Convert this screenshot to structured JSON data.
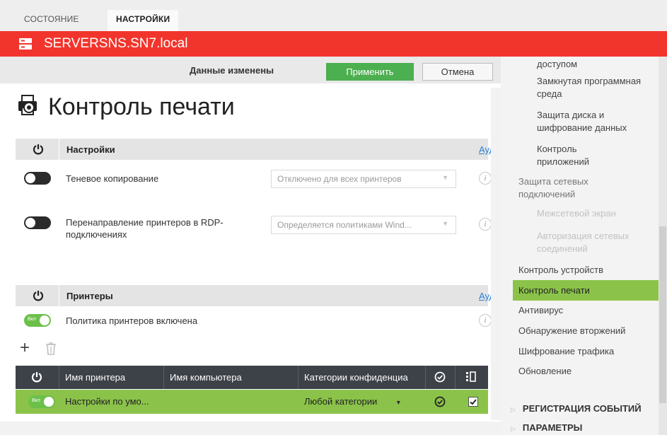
{
  "tabs": [
    {
      "label": "СОСТОЯНИЕ"
    },
    {
      "label": "НАСТРОЙКИ"
    }
  ],
  "server": {
    "name": "SERVERSNS.SN7.local"
  },
  "actionbar": {
    "status": "Данные изменены",
    "apply_label": "Применить",
    "cancel_label": "Отмена"
  },
  "page": {
    "title": "Контроль печати"
  },
  "settings_section": {
    "title": "Настройки",
    "audit_link": "Ауд",
    "options": [
      {
        "label": "Теневое копирование",
        "enabled": false,
        "select_value": "Отключено для всех принтеров"
      },
      {
        "label": "Перенаправление принтеров в RDP-подключениях",
        "enabled": false,
        "select_value": "Определяется политиками Wind..."
      }
    ]
  },
  "printers_section": {
    "title": "Принтеры",
    "audit_link": "Ауд",
    "policy_label": "Политика принтеров включена",
    "policy_toggle_text": "Вкл",
    "policy_enabled": true
  },
  "table": {
    "columns": [
      "Имя принтера",
      "Имя компьютера",
      "Категории конфиденциа"
    ],
    "rows": [
      {
        "toggle_text": "Вкл",
        "printer": "Настройки по умо...",
        "computer": "",
        "category": "Любой категории",
        "checked": true
      }
    ]
  },
  "sidebar": {
    "items": [
      {
        "label": "доступом"
      },
      {
        "label": "Замкнутая программная среда"
      },
      {
        "label": "Защита диска и шифрование данных"
      },
      {
        "label": "Контроль приложений"
      },
      {
        "label": "Защита сетевых подключений"
      },
      {
        "label": "Межсетевой экран"
      },
      {
        "label": "Авторизация сетевых соединений"
      },
      {
        "label": "Контроль устройств"
      },
      {
        "label": "Контроль печати"
      },
      {
        "label": "Антивирус"
      },
      {
        "label": "Обнаружение вторжений"
      },
      {
        "label": "Шифрование трафика"
      },
      {
        "label": "Обновление"
      }
    ],
    "groups": [
      {
        "label": "РЕГИСТРАЦИЯ СОБЫТИЙ"
      },
      {
        "label": "ПАРАМЕТРЫ"
      }
    ]
  },
  "colors": {
    "header_red": "#f2352c",
    "accent_green": "#4caf50",
    "row_green": "#8bc34a",
    "table_head": "#3d4148"
  }
}
